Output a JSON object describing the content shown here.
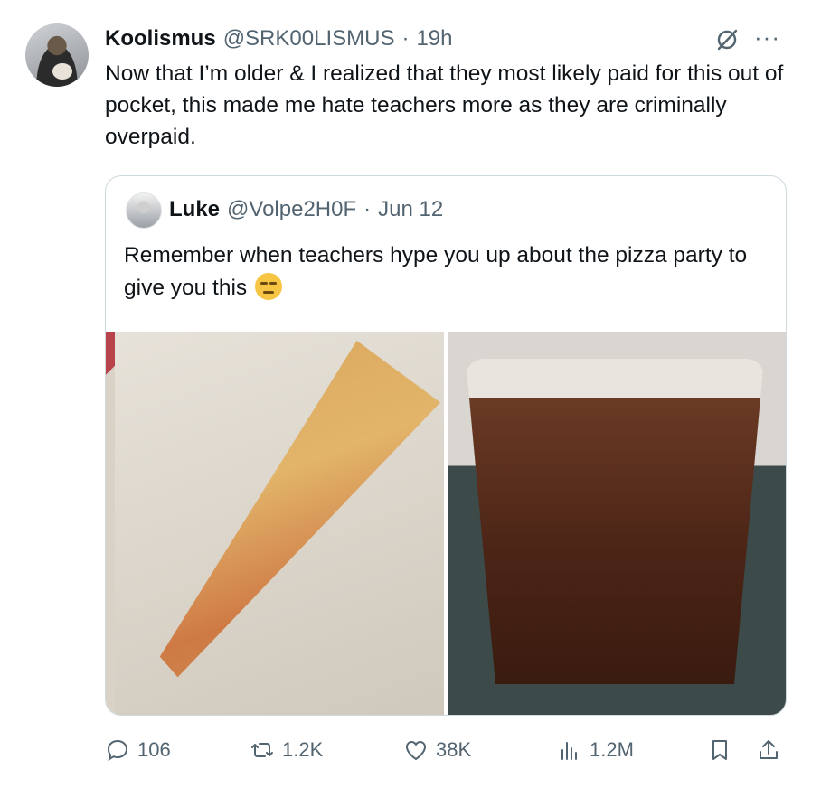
{
  "tweet": {
    "author_name": "Koolismus",
    "author_handle": "@SRK00LISMUS",
    "separator": "·",
    "time": "19h",
    "text": "Now that I’m older & I realized that they most likely paid for this out of pocket, this made me hate teachers more as they are criminally overpaid.",
    "more_label": "···"
  },
  "quote": {
    "author_name": "Luke",
    "author_handle": "@Volpe2H0F",
    "separator": "·",
    "date": "Jun 12",
    "text": "Remember when teachers hype you up about the pizza party to give you this",
    "emoji": "unamused-face"
  },
  "actions": {
    "replies": "106",
    "reposts": "1.2K",
    "likes": "38K",
    "views": "1.2M"
  },
  "icons": [
    "grok-icon",
    "more-icon",
    "reply-icon",
    "repost-icon",
    "like-icon",
    "views-icon",
    "bookmark-icon",
    "share-icon"
  ],
  "colors": {
    "text": "#0f1419",
    "secondary": "#536471",
    "border": "#cfd9de"
  }
}
